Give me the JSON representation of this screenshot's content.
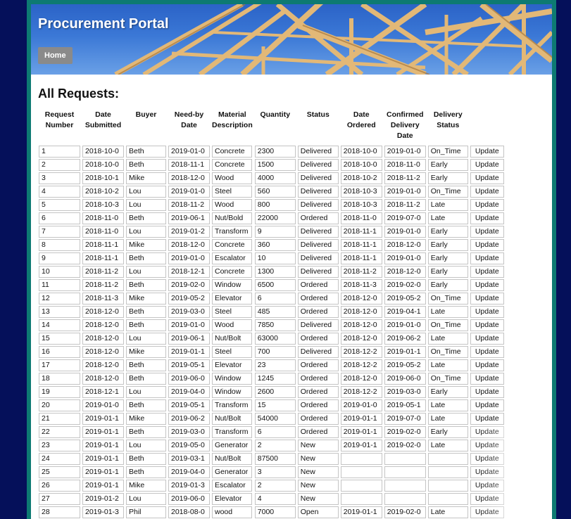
{
  "portal": {
    "title": "Procurement Portal",
    "home_label": "Home"
  },
  "page": {
    "title": "All Requests:"
  },
  "columns": {
    "request_number": "Request Number",
    "date_submitted": "Date Submitted",
    "buyer": "Buyer",
    "need_by_date": "Need-by Date",
    "material_description": "Material Description",
    "quantity": "Quantity",
    "status": "Status",
    "date_ordered": "Date Ordered",
    "confirmed_delivery_date": "Confirmed Delivery Date",
    "delivery_status": "Delivery Status"
  },
  "update_label": "Update",
  "colors": {
    "frame": "#0d7a72",
    "page_bg": "#05105a",
    "home_button": "#8a8a8a"
  },
  "rows": [
    [
      "1",
      "2018-10-0",
      "Beth",
      "2019-01-0",
      "Concrete",
      "2300",
      "Delivered",
      "2018-10-0",
      "2019-01-0",
      "On_Time"
    ],
    [
      "2",
      "2018-10-0",
      "Beth",
      "2018-11-1",
      "Concrete",
      "1500",
      "Delivered",
      "2018-10-0",
      "2018-11-0",
      "Early"
    ],
    [
      "3",
      "2018-10-1",
      "Mike",
      "2018-12-0",
      "Wood",
      "4000",
      "Delivered",
      "2018-10-2",
      "2018-11-2",
      "Early"
    ],
    [
      "4",
      "2018-10-2",
      "Lou",
      "2019-01-0",
      "Steel",
      "560",
      "Delivered",
      "2018-10-3",
      "2019-01-0",
      "On_Time"
    ],
    [
      "5",
      "2018-10-3",
      "Lou",
      "2018-11-2",
      "Wood",
      "800",
      "Delivered",
      "2018-10-3",
      "2018-11-2",
      "Late"
    ],
    [
      "6",
      "2018-11-0",
      "Beth",
      "2019-06-1",
      "Nut/Bold",
      "22000",
      "Ordered",
      "2018-11-0",
      "2019-07-0",
      "Late"
    ],
    [
      "7",
      "2018-11-0",
      "Lou",
      "2019-01-2",
      "Transform",
      "9",
      "Delivered",
      "2018-11-1",
      "2019-01-0",
      "Early"
    ],
    [
      "8",
      "2018-11-1",
      "Mike",
      "2018-12-0",
      "Concrete",
      "360",
      "Delivered",
      "2018-11-1",
      "2018-12-0",
      "Early"
    ],
    [
      "9",
      "2018-11-1",
      "Beth",
      "2019-01-0",
      "Escalator",
      "10",
      "Delivered",
      "2018-11-1",
      "2019-01-0",
      "Early"
    ],
    [
      "10",
      "2018-11-2",
      "Lou",
      "2018-12-1",
      "Concrete",
      "1300",
      "Delivered",
      "2018-11-2",
      "2018-12-0",
      "Early"
    ],
    [
      "11",
      "2018-11-2",
      "Beth",
      "2019-02-0",
      "Window",
      "6500",
      "Ordered",
      "2018-11-3",
      "2019-02-0",
      "Early"
    ],
    [
      "12",
      "2018-11-3",
      "Mike",
      "2019-05-2",
      "Elevator",
      "6",
      "Ordered",
      "2018-12-0",
      "2019-05-2",
      "On_Time"
    ],
    [
      "13",
      "2018-12-0",
      "Beth",
      "2019-03-0",
      "Steel",
      "485",
      "Ordered",
      "2018-12-0",
      "2019-04-1",
      "Late"
    ],
    [
      "14",
      "2018-12-0",
      "Beth",
      "2019-01-0",
      "Wood",
      "7850",
      "Delivered",
      "2018-12-0",
      "2019-01-0",
      "On_Time"
    ],
    [
      "15",
      "2018-12-0",
      "Lou",
      "2019-06-1",
      "Nut/Bolt",
      "63000",
      "Ordered",
      "2018-12-0",
      "2019-06-2",
      "Late"
    ],
    [
      "16",
      "2018-12-0",
      "Mike",
      "2019-01-1",
      "Steel",
      "700",
      "Delivered",
      "2018-12-2",
      "2019-01-1",
      "On_Time"
    ],
    [
      "17",
      "2018-12-0",
      "Beth",
      "2019-05-1",
      "Elevator",
      "23",
      "Ordered",
      "2018-12-2",
      "2019-05-2",
      "Late"
    ],
    [
      "18",
      "2018-12-0",
      "Beth",
      "2019-06-0",
      "Window",
      "1245",
      "Ordered",
      "2018-12-0",
      "2019-06-0",
      "On_Time"
    ],
    [
      "19",
      "2018-12-1",
      "Lou",
      "2019-04-0",
      "Window",
      "2600",
      "Ordered",
      "2018-12-2",
      "2019-03-0",
      "Early"
    ],
    [
      "20",
      "2019-01-0",
      "Beth",
      "2019-05-1",
      "Transform",
      "15",
      "Ordered",
      "2019-01-0",
      "2019-05-1",
      "Late"
    ],
    [
      "21",
      "2019-01-1",
      "Mike",
      "2019-06-2",
      "Nut/Bolt",
      "54000",
      "Ordered",
      "2019-01-1",
      "2019-07-0",
      "Late"
    ],
    [
      "22",
      "2019-01-1",
      "Beth",
      "2019-03-0",
      "Transform",
      "6",
      "Ordered",
      "2019-01-1",
      "2019-02-0",
      "Early"
    ],
    [
      "23",
      "2019-01-1",
      "Lou",
      "2019-05-0",
      "Generator",
      "2",
      "New",
      "2019-01-1",
      "2019-02-0",
      "Late"
    ],
    [
      "24",
      "2019-01-1",
      "Beth",
      "2019-03-1",
      "Nut/Bolt",
      "87500",
      "New",
      "",
      "",
      ""
    ],
    [
      "25",
      "2019-01-1",
      "Beth",
      "2019-04-0",
      "Generator",
      "3",
      "New",
      "",
      "",
      ""
    ],
    [
      "26",
      "2019-01-1",
      "Mike",
      "2019-01-3",
      "Escalator",
      "2",
      "New",
      "",
      "",
      ""
    ],
    [
      "27",
      "2019-01-2",
      "Lou",
      "2019-06-0",
      "Elevator",
      "4",
      "New",
      "",
      "",
      ""
    ],
    [
      "28",
      "2019-01-3",
      "Phil",
      "2018-08-0",
      "wood",
      "7000",
      "Open",
      "2019-01-1",
      "2019-02-0",
      "Late"
    ]
  ]
}
